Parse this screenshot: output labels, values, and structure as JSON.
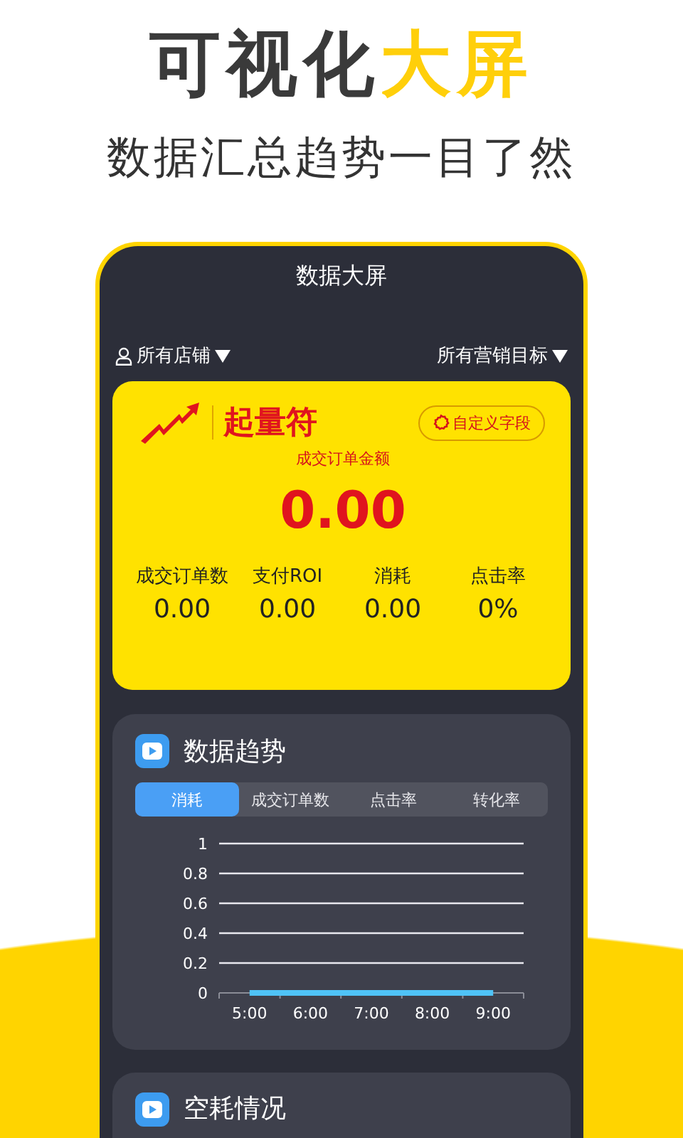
{
  "hero": {
    "title_parts": [
      {
        "text": "可视化",
        "kind": "plain"
      },
      {
        "text": "大屏",
        "kind": "highlight"
      }
    ],
    "subtitle": "数据汇总趋势一目了然"
  },
  "screen": {
    "title": "数据大屏",
    "store_filter": "所有店铺",
    "goal_filter": "所有营销目标"
  },
  "summary_card": {
    "brand": "起量符",
    "custom_button": "自定义字段",
    "main_label": "成交订单金额",
    "main_value": "0.00",
    "metrics": [
      {
        "label": "成交订单数",
        "value": "0.00"
      },
      {
        "label": "支付ROI",
        "value": "0.00"
      },
      {
        "label": "消耗",
        "value": "0.00"
      },
      {
        "label": "点击率",
        "value": "0%"
      }
    ]
  },
  "trend_card": {
    "title": "数据趋势",
    "tabs": [
      {
        "label": "消耗",
        "selected": true
      },
      {
        "label": "成交订单数",
        "selected": false
      },
      {
        "label": "点击率",
        "selected": false
      },
      {
        "label": "转化率",
        "selected": false
      }
    ],
    "chart_data": {
      "type": "line",
      "grid": true,
      "categories": [
        "5:00",
        "6:00",
        "7:00",
        "8:00",
        "9:00"
      ],
      "ylim": [
        0,
        1
      ],
      "yticks": [
        0,
        0.2,
        0.4,
        0.6,
        0.8,
        1
      ],
      "series": [
        {
          "color": "#4fc3f7",
          "values": [
            0,
            0,
            0,
            0,
            0
          ]
        }
      ]
    }
  },
  "next_card": {
    "title": "空耗情况"
  }
}
